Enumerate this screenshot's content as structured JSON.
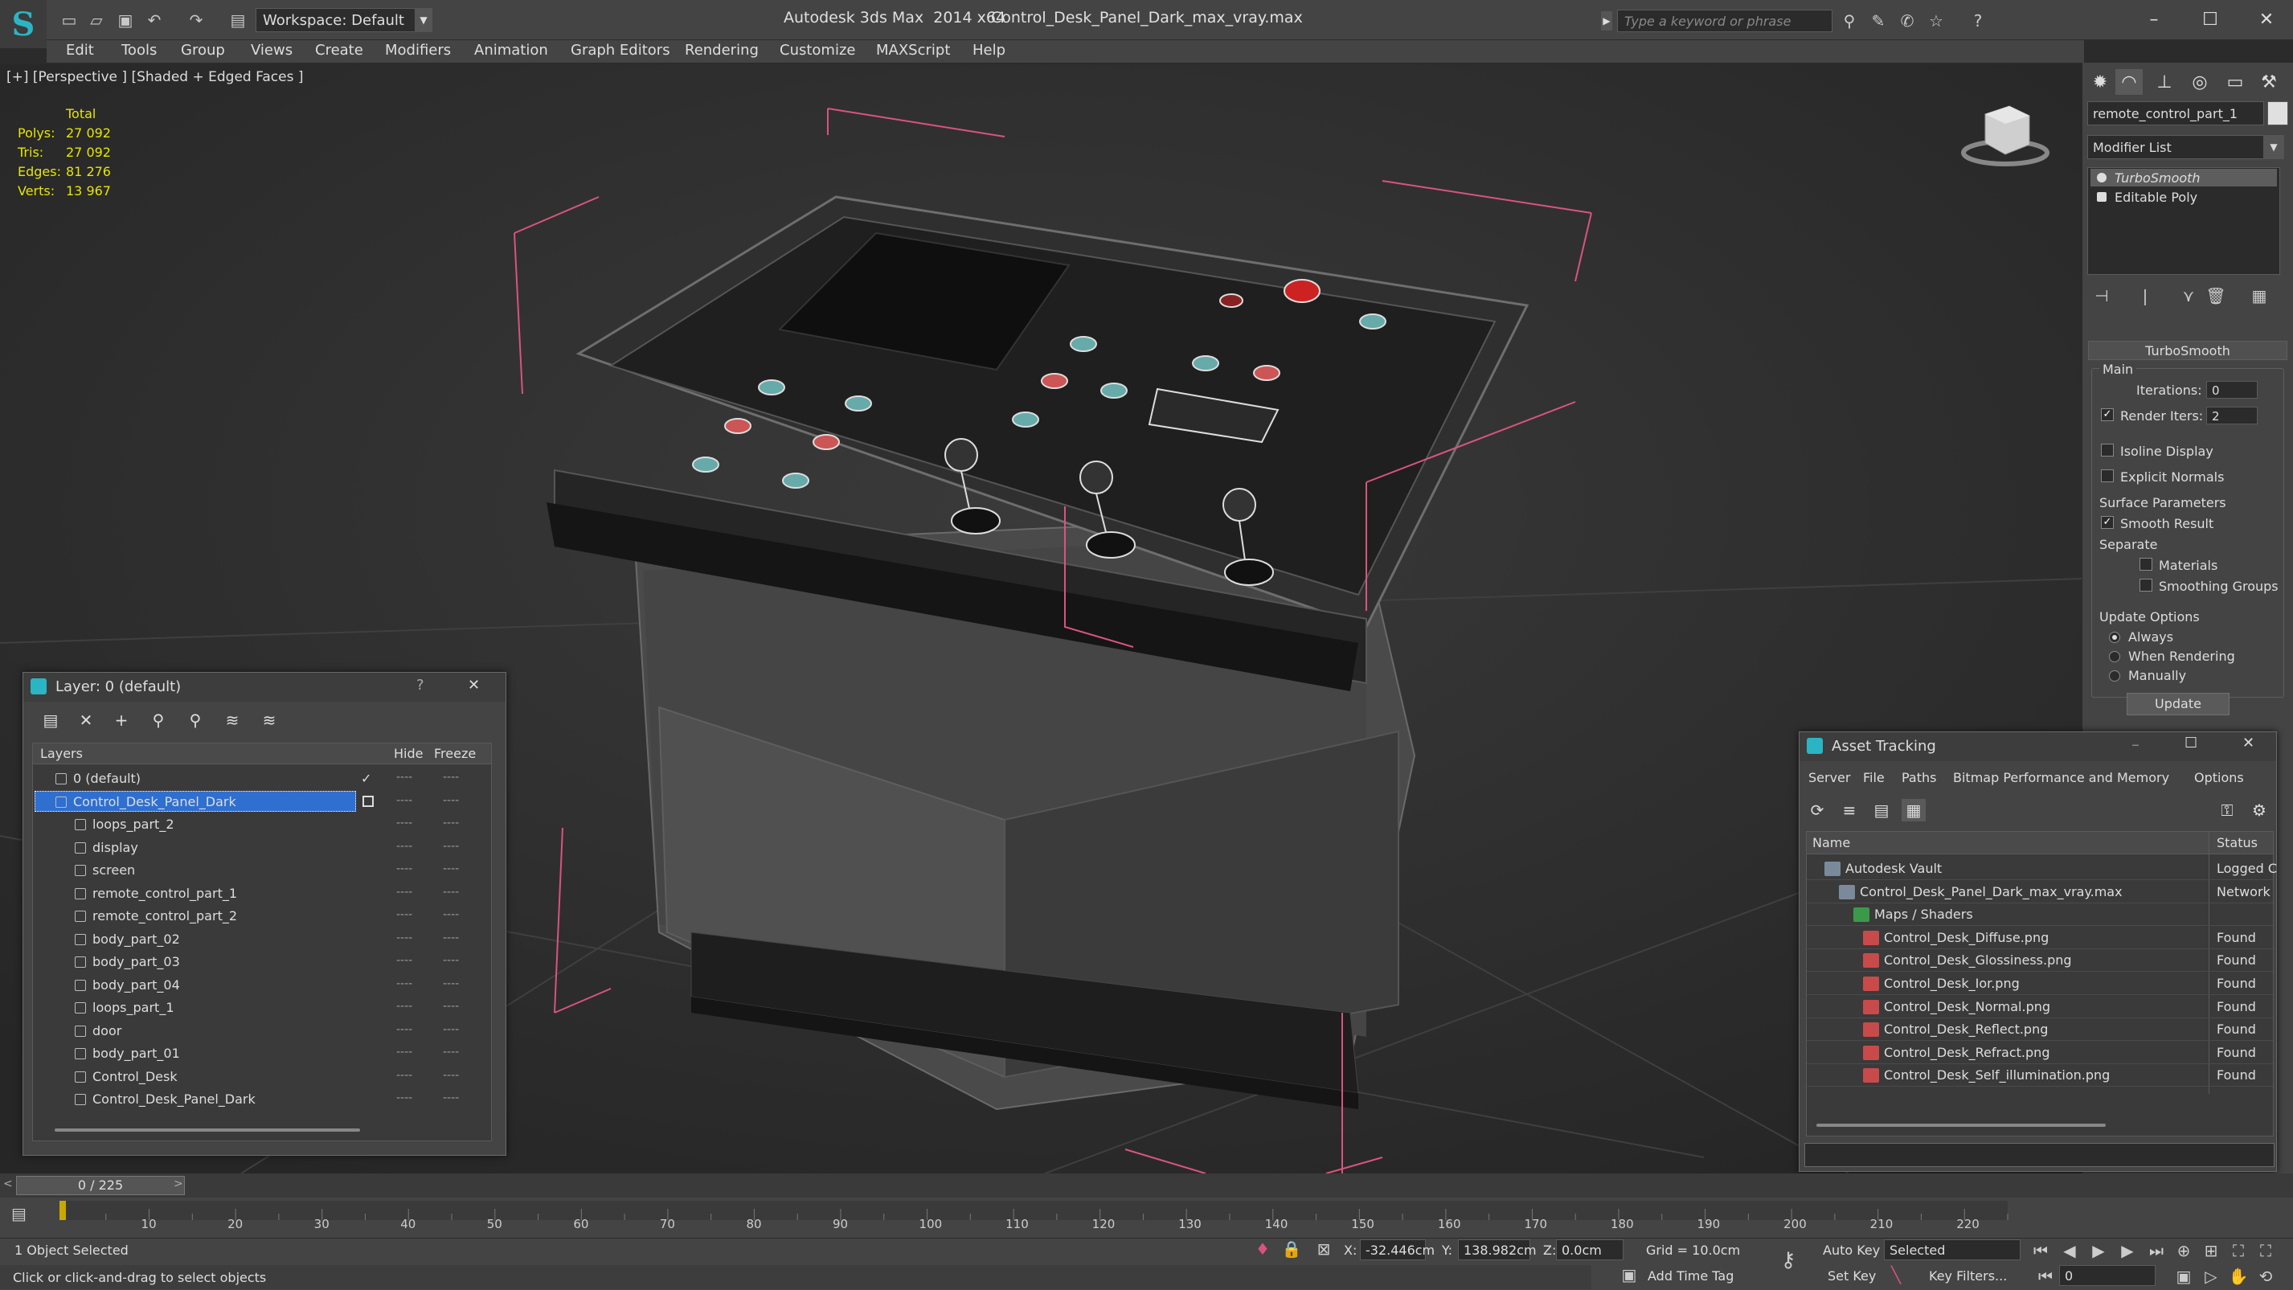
{
  "titlebar": {
    "workspace": "Workspace: Default",
    "app_title": "Autodesk 3ds Max  2014 x64",
    "file_title": "Control_Desk_Panel_Dark_max_vray.max",
    "search_placeholder": "Type a keyword or phrase"
  },
  "menu": [
    "Edit",
    "Tools",
    "Group",
    "Views",
    "Create",
    "Modifiers",
    "Animation",
    "Graph Editors",
    "Rendering",
    "Customize",
    "MAXScript",
    "Help"
  ],
  "viewport": {
    "label": "[+] [Perspective ] [Shaded + Edged Faces ]",
    "stats_header": "Total",
    "stats": [
      {
        "label": "Polys:",
        "value": "27 092"
      },
      {
        "label": "Tris:",
        "value": "27 092"
      },
      {
        "label": "Edges:",
        "value": "81 276"
      },
      {
        "label": "Verts:",
        "value": "13 967"
      }
    ]
  },
  "command_panel": {
    "object_name": "remote_control_part_1",
    "modifier_list": "Modifier List",
    "stack": [
      "TurboSmooth",
      "Editable Poly"
    ],
    "rollout_title": "TurboSmooth",
    "main_label": "Main",
    "iterations_label": "Iterations:",
    "iterations_value": "0",
    "render_iters_label": "Render Iters:",
    "render_iters_value": "2",
    "isoline_label": "Isoline Display",
    "explicit_normals_label": "Explicit Normals",
    "surface_params_label": "Surface Parameters",
    "smooth_result_label": "Smooth Result",
    "separate_label": "Separate",
    "materials_label": "Materials",
    "smoothing_groups_label": "Smoothing Groups",
    "update_options_label": "Update Options",
    "always_label": "Always",
    "when_rendering_label": "When Rendering",
    "manually_label": "Manually",
    "update_button": "Update"
  },
  "layer_dialog": {
    "title": "Layer: 0 (default)",
    "help": "?",
    "close": "✕",
    "col_layers": "Layers",
    "col_hide": "Hide",
    "col_freeze": "Freeze",
    "rows": [
      {
        "name": "0 (default)",
        "indent": 0,
        "check": "✓"
      },
      {
        "name": "Control_Desk_Panel_Dark",
        "indent": 0,
        "selected": true
      },
      {
        "name": "loops_part_2",
        "indent": 1
      },
      {
        "name": "display",
        "indent": 1
      },
      {
        "name": "screen",
        "indent": 1
      },
      {
        "name": "remote_control_part_1",
        "indent": 1
      },
      {
        "name": "remote_control_part_2",
        "indent": 1
      },
      {
        "name": "body_part_02",
        "indent": 1
      },
      {
        "name": "body_part_03",
        "indent": 1
      },
      {
        "name": "body_part_04",
        "indent": 1
      },
      {
        "name": "loops_part_1",
        "indent": 1
      },
      {
        "name": "door",
        "indent": 1
      },
      {
        "name": "body_part_01",
        "indent": 1
      },
      {
        "name": "Control_Desk",
        "indent": 1
      },
      {
        "name": "Control_Desk_Panel_Dark",
        "indent": 1
      }
    ],
    "dash": "----"
  },
  "asset_tracking": {
    "title": "Asset Tracking",
    "menu": [
      "Server",
      "File",
      "Paths",
      "Bitmap Performance and Memory",
      "Options"
    ],
    "col_name": "Name",
    "col_status": "Status",
    "rows": [
      {
        "name": "Autodesk Vault",
        "status": "Logged C",
        "indent": 0
      },
      {
        "name": "Control_Desk_Panel_Dark_max_vray.max",
        "status": "Network",
        "indent": 1
      },
      {
        "name": "Maps / Shaders",
        "status": "",
        "indent": 2
      },
      {
        "name": "Control_Desk_Diffuse.png",
        "status": "Found",
        "indent": 3
      },
      {
        "name": "Control_Desk_Glossiness.png",
        "status": "Found",
        "indent": 3
      },
      {
        "name": "Control_Desk_Ior.png",
        "status": "Found",
        "indent": 3
      },
      {
        "name": "Control_Desk_Normal.png",
        "status": "Found",
        "indent": 3
      },
      {
        "name": "Control_Desk_Reflect.png",
        "status": "Found",
        "indent": 3
      },
      {
        "name": "Control_Desk_Refract.png",
        "status": "Found",
        "indent": 3
      },
      {
        "name": "Control_Desk_Self_illumination.png",
        "status": "Found",
        "indent": 3
      }
    ]
  },
  "timeline": {
    "slider": "0 / 225",
    "ticks": [
      "10",
      "20",
      "30",
      "40",
      "50",
      "60",
      "70",
      "80",
      "90",
      "100",
      "110",
      "120",
      "130",
      "140",
      "150",
      "160",
      "170",
      "180",
      "190",
      "200",
      "210",
      "220"
    ]
  },
  "status": {
    "selection": "1 Object Selected",
    "prompt": "Click or click-and-drag to select objects",
    "x_label": "X:",
    "x_value": "-32.446cm",
    "y_label": "Y:",
    "y_value": "138.982cm",
    "z_label": "Z:",
    "z_value": "0.0cm",
    "grid": "Grid = 10.0cm",
    "auto_key": "Auto Key",
    "set_key": "Set Key",
    "selected_dropdown": "Selected",
    "key_filters": "Key Filters...",
    "add_time_tag": "Add Time Tag",
    "frame_value": "0"
  },
  "colors": {
    "accent": "#2bb5c4",
    "selection": "#2f6fd0",
    "stats": "#e6e600",
    "gizmo": "#d9547c"
  }
}
